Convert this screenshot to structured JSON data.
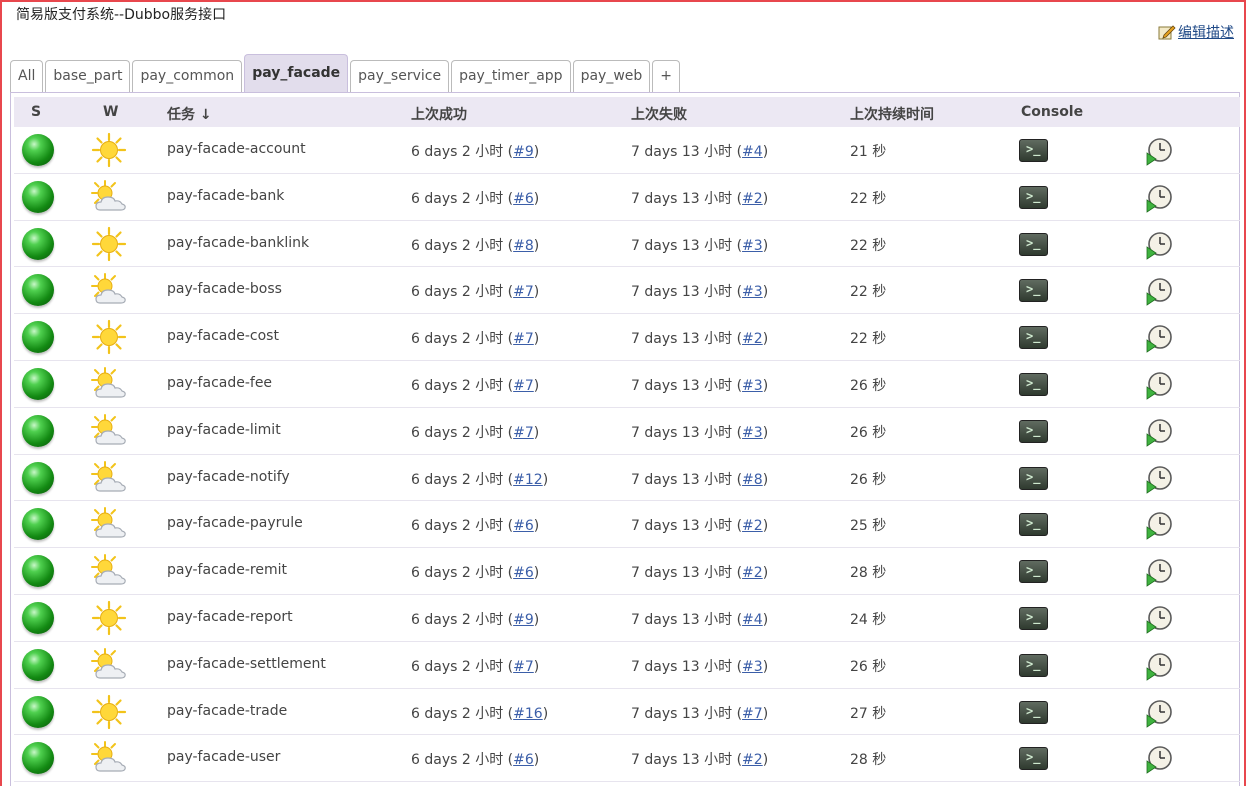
{
  "page": {
    "title": "简易版支付系统--Dubbo服务接口",
    "edit_description": "编辑描述"
  },
  "tabs": [
    {
      "label": "All",
      "active": false
    },
    {
      "label": "base_part",
      "active": false
    },
    {
      "label": "pay_common",
      "active": false
    },
    {
      "label": "pay_facade",
      "active": true
    },
    {
      "label": "pay_service",
      "active": false
    },
    {
      "label": "pay_timer_app",
      "active": false
    },
    {
      "label": "pay_web",
      "active": false
    },
    {
      "label": "+",
      "active": false
    }
  ],
  "columns": {
    "s": "S",
    "w": "W",
    "job": "任务 ↓",
    "last_success": "上次成功",
    "last_failure": "上次失败",
    "last_duration": "上次持续时间",
    "console": "Console"
  },
  "rows": [
    {
      "name": "pay-facade-account",
      "weather": "sunny",
      "succ": "6 days 2 小时",
      "succ_build": "#9",
      "fail": "7 days 13 小时",
      "fail_build": "#4",
      "duration": "21 秒"
    },
    {
      "name": "pay-facade-bank",
      "weather": "partly-cloudy",
      "succ": "6 days 2 小时",
      "succ_build": "#6",
      "fail": "7 days 13 小时",
      "fail_build": "#2",
      "duration": "22 秒"
    },
    {
      "name": "pay-facade-banklink",
      "weather": "sunny",
      "succ": "6 days 2 小时",
      "succ_build": "#8",
      "fail": "7 days 13 小时",
      "fail_build": "#3",
      "duration": "22 秒"
    },
    {
      "name": "pay-facade-boss",
      "weather": "partly-cloudy",
      "succ": "6 days 2 小时",
      "succ_build": "#7",
      "fail": "7 days 13 小时",
      "fail_build": "#3",
      "duration": "22 秒"
    },
    {
      "name": "pay-facade-cost",
      "weather": "sunny",
      "succ": "6 days 2 小时",
      "succ_build": "#7",
      "fail": "7 days 13 小时",
      "fail_build": "#2",
      "duration": "22 秒"
    },
    {
      "name": "pay-facade-fee",
      "weather": "partly-cloudy",
      "succ": "6 days 2 小时",
      "succ_build": "#7",
      "fail": "7 days 13 小时",
      "fail_build": "#3",
      "duration": "26 秒"
    },
    {
      "name": "pay-facade-limit",
      "weather": "partly-cloudy",
      "succ": "6 days 2 小时",
      "succ_build": "#7",
      "fail": "7 days 13 小时",
      "fail_build": "#3",
      "duration": "26 秒"
    },
    {
      "name": "pay-facade-notify",
      "weather": "partly-cloudy",
      "succ": "6 days 2 小时",
      "succ_build": "#12",
      "fail": "7 days 13 小时",
      "fail_build": "#8",
      "duration": "26 秒"
    },
    {
      "name": "pay-facade-payrule",
      "weather": "partly-cloudy",
      "succ": "6 days 2 小时",
      "succ_build": "#6",
      "fail": "7 days 13 小时",
      "fail_build": "#2",
      "duration": "25 秒"
    },
    {
      "name": "pay-facade-remit",
      "weather": "partly-cloudy",
      "succ": "6 days 2 小时",
      "succ_build": "#6",
      "fail": "7 days 13 小时",
      "fail_build": "#2",
      "duration": "28 秒"
    },
    {
      "name": "pay-facade-report",
      "weather": "sunny",
      "succ": "6 days 2 小时",
      "succ_build": "#9",
      "fail": "7 days 13 小时",
      "fail_build": "#4",
      "duration": "24 秒"
    },
    {
      "name": "pay-facade-settlement",
      "weather": "partly-cloudy",
      "succ": "6 days 2 小时",
      "succ_build": "#7",
      "fail": "7 days 13 小时",
      "fail_build": "#3",
      "duration": "26 秒"
    },
    {
      "name": "pay-facade-trade",
      "weather": "sunny",
      "succ": "6 days 2 小时",
      "succ_build": "#16",
      "fail": "7 days 13 小时",
      "fail_build": "#7",
      "duration": "27 秒"
    },
    {
      "name": "pay-facade-user",
      "weather": "partly-cloudy",
      "succ": "6 days 2 小时",
      "succ_build": "#6",
      "fail": "7 days 13 小时",
      "fail_build": "#2",
      "duration": "28 秒"
    }
  ],
  "icons": {
    "status": "green-ball-icon",
    "weather_sunny": "sun-icon",
    "weather_partly_cloudy": "sun-cloud-icon",
    "console": "terminal-icon",
    "schedule": "schedule-build-icon",
    "edit": "edit-icon"
  },
  "colors": {
    "frame_border": "#e8474d",
    "active_tab": "#e2ddec",
    "header_bg": "#ece8f3",
    "link": "#3b5ea8",
    "status_success": "#138a13"
  },
  "console_glyph": ">_"
}
